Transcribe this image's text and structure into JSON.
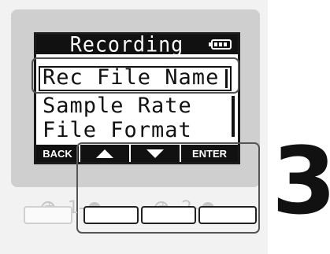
{
  "screen": {
    "title": "Recording",
    "battery_icon": "battery-icon",
    "menu_items": [
      {
        "label": "Rec File Name",
        "selected": true
      },
      {
        "label": "Sample Rate",
        "selected": false
      },
      {
        "label": "File Format",
        "selected": false
      }
    ],
    "softkeys": [
      {
        "label": "BACK"
      },
      {
        "icon": "arrow-up-icon"
      },
      {
        "icon": "arrow-down-icon"
      },
      {
        "label": "ENTER"
      }
    ]
  },
  "channels": [
    {
      "label": "-1-"
    },
    {
      "label": "-2-"
    }
  ],
  "step": "3",
  "colors": {
    "screen_bg": "#ffffff",
    "screen_ink": "#111111",
    "bezel": "#cfcfcf",
    "callout": "#555555",
    "inactive": "#c6c6c6"
  }
}
